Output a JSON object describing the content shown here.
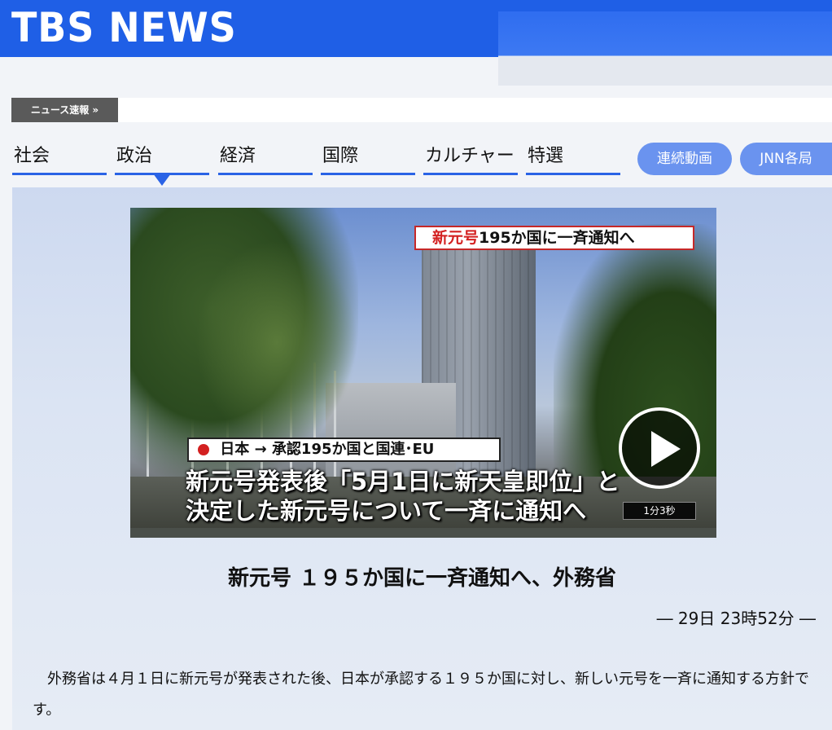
{
  "header": {
    "logo": "TBS NEWS",
    "brand_color": "#1f5fe6"
  },
  "breaking": {
    "label": "ニュース速報 »"
  },
  "nav": {
    "tabs": [
      {
        "label": "社会"
      },
      {
        "label": "政治",
        "active": true
      },
      {
        "label": "経済"
      },
      {
        "label": "国際"
      },
      {
        "label": "カルチャー"
      },
      {
        "label": "特選"
      }
    ],
    "pills": [
      {
        "label": "連続動画"
      },
      {
        "label": "JNN各局"
      }
    ],
    "accent_color": "#2a63e6"
  },
  "video": {
    "caption_top_red": "新元号",
    "caption_top_black": "195か国に一斉通知へ",
    "caption_mid_country": "日本",
    "caption_mid_arrow": "→",
    "caption_mid_rest": "承認195か国と国連･EU",
    "caption_line1": "新元号発表後「5月1日に新天皇即位」と",
    "caption_line2": "決定した新元号について一斉に通知へ",
    "duration": "1分3秒",
    "play_icon": "play-icon"
  },
  "article": {
    "title": "新元号 １９５か国に一斉通知へ、外務省",
    "date": "―  29日 23時52分  ―",
    "body": "外務省は４月１日に新元号が発表された後、日本が承認する１９５か国に対し、新しい元号を一斉に通知する方針です。"
  }
}
